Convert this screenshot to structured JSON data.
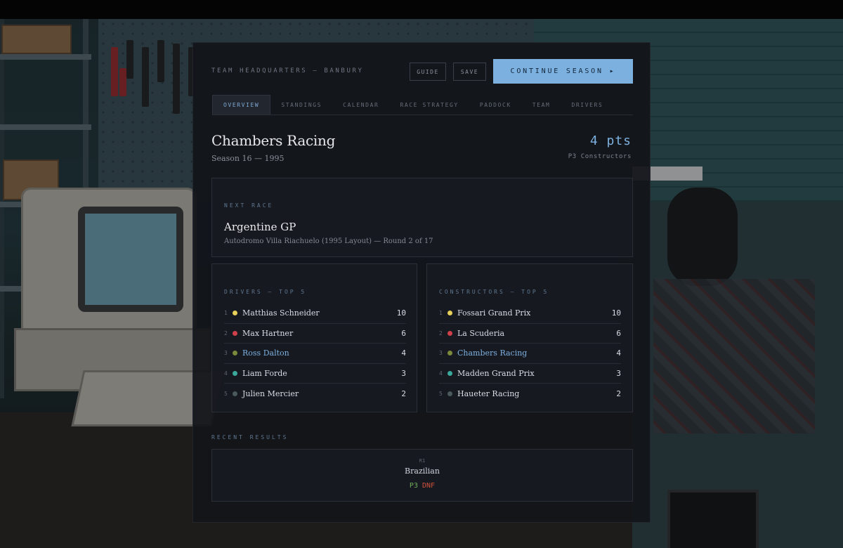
{
  "header": {
    "hq_label": "TEAM HEADQUARTERS — BANBURY",
    "guide_label": "GUIDE",
    "save_label": "SAVE",
    "continue_label": "CONTINUE SEASON ▸"
  },
  "tabs": [
    {
      "label": "OVERVIEW",
      "active": true
    },
    {
      "label": "STANDINGS"
    },
    {
      "label": "CALENDAR"
    },
    {
      "label": "RACE STRATEGY"
    },
    {
      "label": "PADDOCK"
    },
    {
      "label": "TEAM"
    },
    {
      "label": "DRIVERS"
    }
  ],
  "team": {
    "name": "Chambers Racing",
    "season": "Season 16 — 1995",
    "points": "4 pts",
    "constructor_position": "P3 Constructors"
  },
  "next_race": {
    "label": "NEXT RACE",
    "name": "Argentine GP",
    "details": "Autodromo Villa Riachuelo (1995 Layout) — Round 2 of 17"
  },
  "drivers": {
    "label": "DRIVERS — TOP 5",
    "rows": [
      {
        "pos": "1",
        "name": "Matthias Schneider",
        "points": "10",
        "color": "#e8d05a"
      },
      {
        "pos": "2",
        "name": "Max Hartner",
        "points": "6",
        "color": "#d0404a"
      },
      {
        "pos": "3",
        "name": "Ross Dalton",
        "points": "4",
        "color": "#7a8a3a",
        "own": true
      },
      {
        "pos": "4",
        "name": "Liam Forde",
        "points": "3",
        "color": "#3aa89a"
      },
      {
        "pos": "5",
        "name": "Julien Mercier",
        "points": "2",
        "color": "#4a5a5a"
      }
    ]
  },
  "constructors": {
    "label": "CONSTRUCTORS — TOP 5",
    "rows": [
      {
        "pos": "1",
        "name": "Fossari Grand Prix",
        "points": "10",
        "color": "#e8d05a"
      },
      {
        "pos": "2",
        "name": "La Scuderia",
        "points": "6",
        "color": "#d0404a"
      },
      {
        "pos": "3",
        "name": "Chambers Racing",
        "points": "4",
        "color": "#7a8a3a",
        "own": true
      },
      {
        "pos": "4",
        "name": "Madden Grand Prix",
        "points": "3",
        "color": "#3aa89a"
      },
      {
        "pos": "5",
        "name": "Haueter Racing",
        "points": "2",
        "color": "#4a5a5a"
      }
    ]
  },
  "recent_results": {
    "label": "RECENT RESULTS",
    "round": "R1",
    "race": "Brazilian",
    "result_1": "P3",
    "result_2": "DNF"
  },
  "colors": {
    "accent": "#7cb0df",
    "finish_green": "#6fae5a",
    "dnf_red": "#d0503a"
  }
}
